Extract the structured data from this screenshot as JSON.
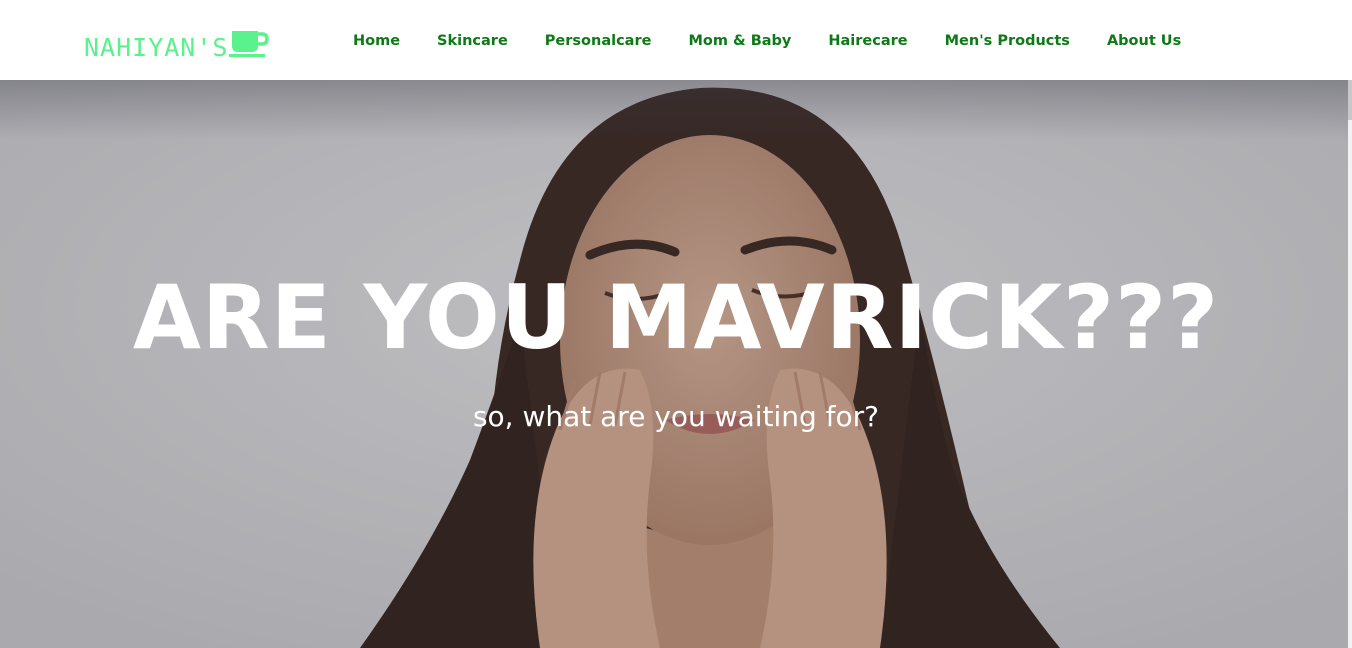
{
  "brand": {
    "name": "NAHIYAN'S",
    "icon": "coffee-cup-icon",
    "color": "#5af28c"
  },
  "nav": {
    "link_color": "#0e7a17",
    "items": [
      {
        "label": "Home"
      },
      {
        "label": "Skincare"
      },
      {
        "label": "Personalcare"
      },
      {
        "label": "Mom & Baby"
      },
      {
        "label": "Hairecare"
      },
      {
        "label": "Men's Products"
      },
      {
        "label": "About Us"
      }
    ]
  },
  "hero": {
    "title": "ARE YOU MAVRICK???",
    "subtitle": "so, what are you waiting for?",
    "image": "woman-washing-face-photo"
  }
}
